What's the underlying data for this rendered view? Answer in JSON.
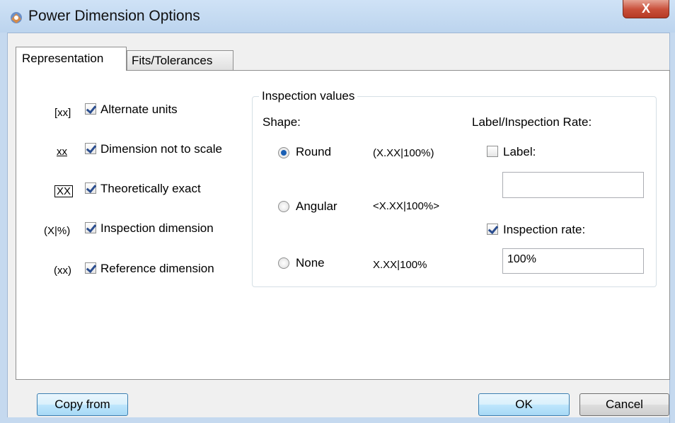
{
  "window": {
    "title": "Power Dimension Options",
    "close_label": "X"
  },
  "tabs": [
    {
      "label": "Representation",
      "active": true
    },
    {
      "label": "Fits/Tolerances",
      "active": false
    }
  ],
  "options": [
    {
      "symbol": "[xx]",
      "label": "Alternate units",
      "checked": true
    },
    {
      "symbol": "xx",
      "label": "Dimension not to scale",
      "checked": true
    },
    {
      "symbol": "XX",
      "label": "Theoretically exact",
      "checked": true
    },
    {
      "symbol": "(X|%)",
      "label": "Inspection dimension",
      "checked": true
    },
    {
      "symbol": "(xx)",
      "label": "Reference dimension",
      "checked": true
    }
  ],
  "inspection": {
    "group_label": "Inspection values",
    "shape_label": "Shape:",
    "rate_header": "Label/Inspection Rate:",
    "shapes": [
      {
        "label": "Round",
        "preview": "(X.XX|100%)",
        "selected": true
      },
      {
        "label": "Angular",
        "preview": "<X.XX|100%>",
        "selected": false
      },
      {
        "label": "None",
        "preview": "X.XX|100%",
        "selected": false
      }
    ],
    "label_checkbox": {
      "label": "Label:",
      "checked": false,
      "value": ""
    },
    "rate_checkbox": {
      "label": "Inspection rate:",
      "checked": true,
      "value": "100%"
    }
  },
  "buttons": {
    "copy_from": "Copy from",
    "ok": "OK",
    "cancel": "Cancel"
  }
}
